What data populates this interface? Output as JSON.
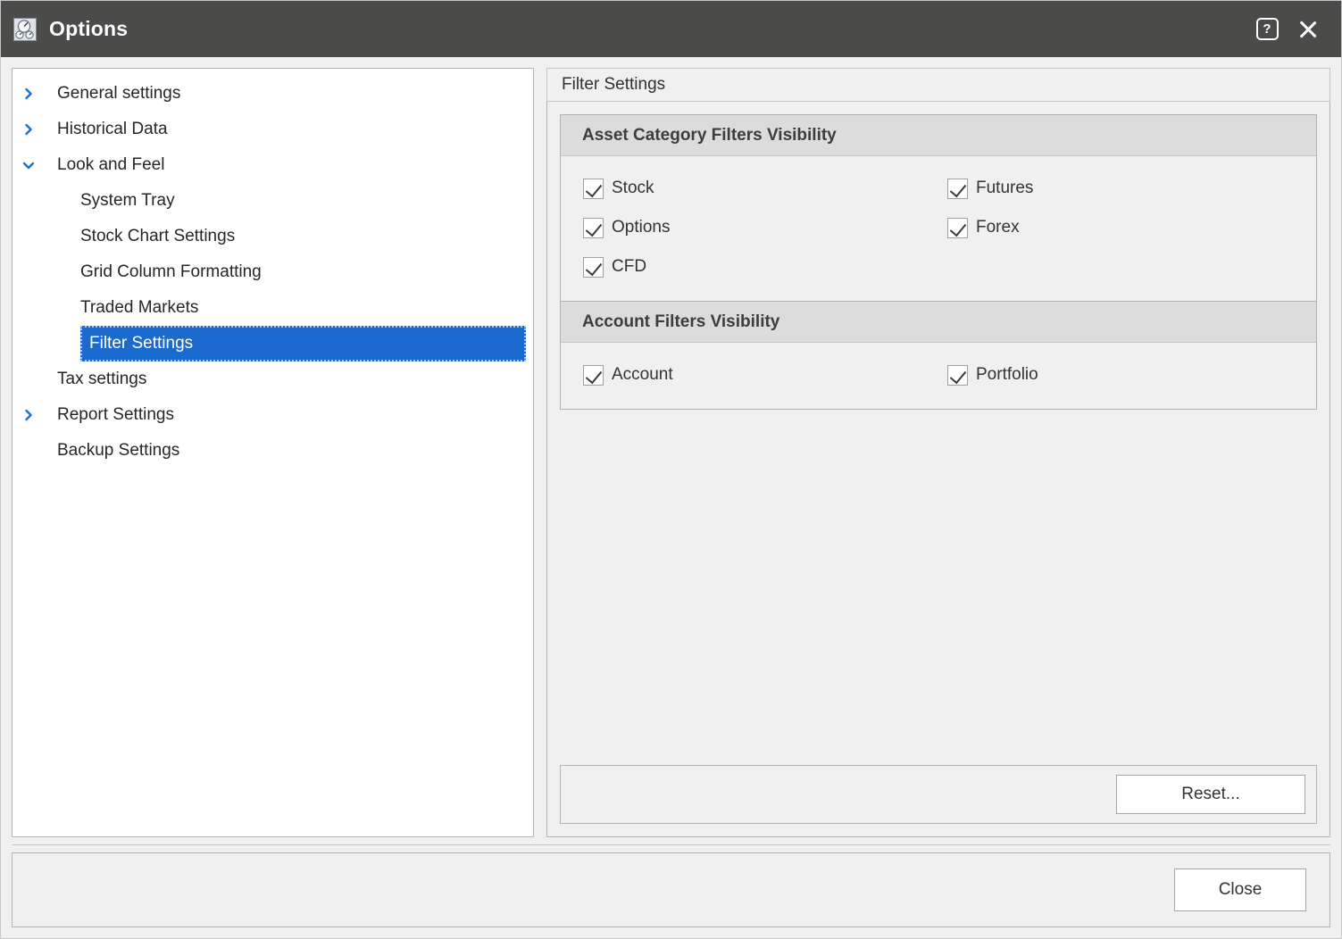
{
  "window": {
    "title": "Options",
    "icon": "options-gauge-icon",
    "titlebar_bg": "#4b4b49",
    "help_label": "?",
    "help_title": "Help",
    "close_title": "Close"
  },
  "sidebar": {
    "items": [
      {
        "label": "General settings",
        "level": 0,
        "expandable": true,
        "expanded": false,
        "selected": false
      },
      {
        "label": "Historical Data",
        "level": 0,
        "expandable": true,
        "expanded": false,
        "selected": false
      },
      {
        "label": "Look and Feel",
        "level": 0,
        "expandable": true,
        "expanded": true,
        "selected": false
      },
      {
        "label": "System Tray",
        "level": 1,
        "expandable": false,
        "expanded": false,
        "selected": false
      },
      {
        "label": "Stock Chart Settings",
        "level": 1,
        "expandable": false,
        "expanded": false,
        "selected": false
      },
      {
        "label": "Grid Column Formatting",
        "level": 1,
        "expandable": false,
        "expanded": false,
        "selected": false
      },
      {
        "label": "Traded Markets",
        "level": 1,
        "expandable": false,
        "expanded": false,
        "selected": false
      },
      {
        "label": "Filter Settings",
        "level": 1,
        "expandable": false,
        "expanded": false,
        "selected": true
      },
      {
        "label": "Tax settings",
        "level": 0,
        "expandable": false,
        "expanded": false,
        "selected": false
      },
      {
        "label": "Report Settings",
        "level": 0,
        "expandable": true,
        "expanded": false,
        "selected": false
      },
      {
        "label": "Backup Settings",
        "level": 0,
        "expandable": false,
        "expanded": false,
        "selected": false
      }
    ],
    "selection_color": "#1a6ad0",
    "chevron_color": "#1f6fc9"
  },
  "panel": {
    "header_title": "Filter Settings",
    "groups": [
      {
        "title": "Asset Category Filters Visibility",
        "checkboxes": [
          {
            "label": "Stock",
            "checked": true,
            "column": 0
          },
          {
            "label": "Futures",
            "checked": true,
            "column": 1
          },
          {
            "label": "Options",
            "checked": true,
            "column": 0
          },
          {
            "label": "Forex",
            "checked": true,
            "column": 1
          },
          {
            "label": "CFD",
            "checked": true,
            "column": 0
          }
        ]
      },
      {
        "title": "Account Filters Visibility",
        "checkboxes": [
          {
            "label": "Account",
            "checked": true,
            "column": 0
          },
          {
            "label": "Portfolio",
            "checked": true,
            "column": 1
          }
        ]
      }
    ],
    "reset_button": "Reset..."
  },
  "footer": {
    "close_button": "Close"
  }
}
